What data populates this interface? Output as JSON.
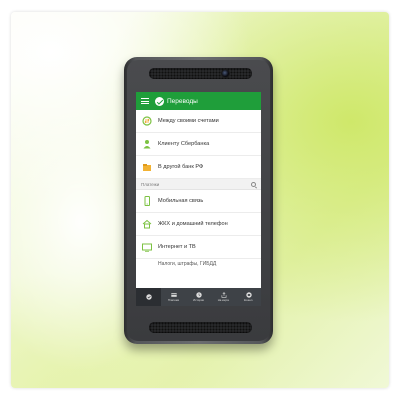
{
  "app": {
    "title": "Переводы",
    "accent_color": "#1f9e3a"
  },
  "transfers": [
    {
      "label": "Между своими счетами",
      "icon": "accounts-exchange-icon"
    },
    {
      "label": "Клиенту Сбербанка",
      "icon": "person-icon"
    },
    {
      "label": "В другой банк РФ",
      "icon": "bank-folder-icon"
    }
  ],
  "payments_section": {
    "title": "Платежи",
    "search_icon": "search-icon"
  },
  "payments": [
    {
      "label": "Мобильная связь",
      "icon": "mobile-phone-icon"
    },
    {
      "label": "ЖКХ и домашний телефон",
      "icon": "house-icon"
    },
    {
      "label": "Интернет и ТВ",
      "icon": "tv-icon"
    },
    {
      "label": "Налоги, штрафы, ГИБДД",
      "icon": "tax-icon"
    }
  ],
  "bottom_nav": [
    {
      "label": "",
      "icon": "sberbank-logo-icon"
    },
    {
      "label": "Платежи",
      "icon": "payments-card-icon"
    },
    {
      "label": "История",
      "icon": "clock-icon"
    },
    {
      "label": "На карте",
      "icon": "share-icon"
    },
    {
      "label": "Кошел.",
      "icon": "wallet-icon"
    }
  ]
}
